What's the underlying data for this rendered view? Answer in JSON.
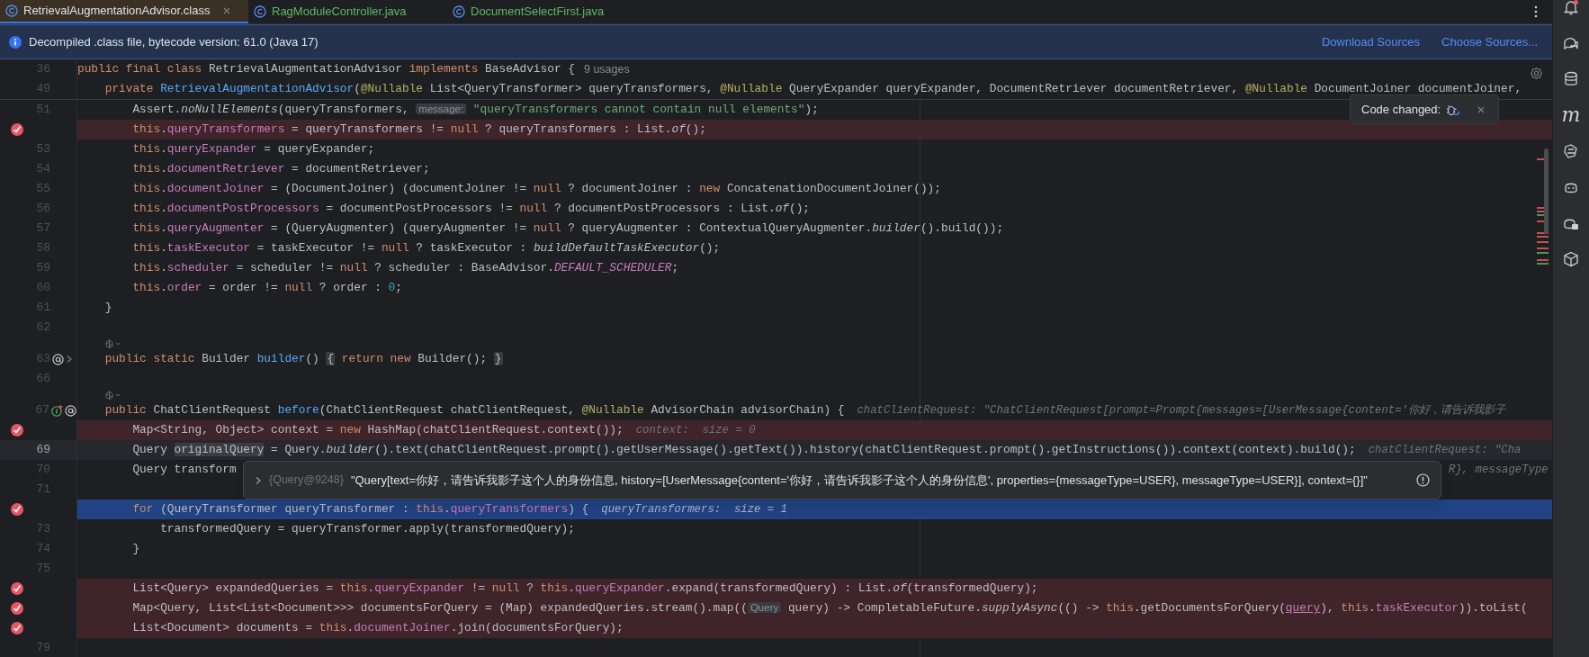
{
  "tabs": [
    {
      "label": "RetrievalAugmentationAdvisor.class",
      "selected": true,
      "color": "#dfe1e5"
    },
    {
      "label": "RagModuleController.java",
      "selected": false,
      "color": "#5fb865"
    },
    {
      "label": "DocumentSelectFirst.java",
      "selected": false,
      "color": "#5fb865"
    }
  ],
  "banner": {
    "message": "Decompiled .class file, bytecode version: 61.0 (Java 17)",
    "links": [
      "Download Sources",
      "Choose Sources..."
    ]
  },
  "sticky_lines": [
    {
      "number": "36",
      "tokens": [
        {
          "text": "public final class ",
          "kind": "keyword"
        },
        {
          "text": "RetrievalAugmentationAdvisor ",
          "kind": "plain"
        },
        {
          "text": "implements ",
          "kind": "keyword"
        },
        {
          "text": "BaseAdvisor {",
          "kind": "plain"
        }
      ],
      "hint": {
        "kind": "usages",
        "text": "9 usages"
      }
    },
    {
      "number": "49",
      "tokens": [
        {
          "text": "    private ",
          "kind": "keyword"
        },
        {
          "text": "RetrievalAugmentationAdvisor",
          "kind": "method"
        },
        {
          "text": "(",
          "kind": "plain"
        },
        {
          "text": "@Nullable",
          "kind": "annotation"
        },
        {
          "text": " List<QueryTransformer> queryTransformers, ",
          "kind": "plain"
        },
        {
          "text": "@Nullable",
          "kind": "annotation"
        },
        {
          "text": " QueryExpander queryExpander, DocumentRetriever documentRetriever, ",
          "kind": "plain"
        },
        {
          "text": "@Nullable",
          "kind": "annotation"
        },
        {
          "text": " DocumentJoiner documentJoiner, ",
          "kind": "plain"
        }
      ]
    }
  ],
  "lines": [
    {
      "kind": "code",
      "number": "51",
      "breakpoint": false,
      "execution_point": false,
      "caret_line": false,
      "tokens": [
        {
          "text": "        Assert.",
          "kind": "plain"
        },
        {
          "text": "noNullElements",
          "kind": "static"
        },
        {
          "text": "(queryTransformers, ",
          "kind": "plain"
        },
        {
          "text": "message:",
          "kind": "param_hint"
        },
        {
          "text": " \"queryTransformers cannot contain null elements\"",
          "kind": "string"
        },
        {
          "text": ");",
          "kind": "plain"
        }
      ]
    },
    {
      "kind": "code",
      "breakpoint": true,
      "execution_point": false,
      "caret_line": false,
      "tokens": [
        {
          "text": "        this",
          "kind": "keyword"
        },
        {
          "text": ".",
          "kind": "plain"
        },
        {
          "text": "queryTransformers",
          "kind": "field"
        },
        {
          "text": " = queryTransformers != ",
          "kind": "plain"
        },
        {
          "text": "null",
          "kind": "keyword"
        },
        {
          "text": " ? queryTransformers : List.",
          "kind": "plain"
        },
        {
          "text": "of",
          "kind": "static"
        },
        {
          "text": "();",
          "kind": "plain"
        }
      ]
    },
    {
      "kind": "code",
      "number": "53",
      "breakpoint": false,
      "execution_point": false,
      "caret_line": false,
      "tokens": [
        {
          "text": "        this",
          "kind": "keyword"
        },
        {
          "text": ".",
          "kind": "plain"
        },
        {
          "text": "queryExpander",
          "kind": "field"
        },
        {
          "text": " = queryExpander;",
          "kind": "plain"
        }
      ]
    },
    {
      "kind": "code",
      "number": "54",
      "breakpoint": false,
      "execution_point": false,
      "caret_line": false,
      "tokens": [
        {
          "text": "        this",
          "kind": "keyword"
        },
        {
          "text": ".",
          "kind": "plain"
        },
        {
          "text": "documentRetriever",
          "kind": "field"
        },
        {
          "text": " = documentRetriever;",
          "kind": "plain"
        }
      ]
    },
    {
      "kind": "code",
      "number": "55",
      "breakpoint": false,
      "execution_point": false,
      "caret_line": false,
      "tokens": [
        {
          "text": "        this",
          "kind": "keyword"
        },
        {
          "text": ".",
          "kind": "plain"
        },
        {
          "text": "documentJoiner",
          "kind": "field"
        },
        {
          "text": " = (DocumentJoiner) (documentJoiner != ",
          "kind": "plain"
        },
        {
          "text": "null",
          "kind": "keyword"
        },
        {
          "text": " ? documentJoiner : ",
          "kind": "plain"
        },
        {
          "text": "new ",
          "kind": "keyword"
        },
        {
          "text": "ConcatenationDocumentJoiner());",
          "kind": "plain"
        }
      ]
    },
    {
      "kind": "code",
      "number": "56",
      "breakpoint": false,
      "execution_point": false,
      "caret_line": false,
      "tokens": [
        {
          "text": "        this",
          "kind": "keyword"
        },
        {
          "text": ".",
          "kind": "plain"
        },
        {
          "text": "documentPostProcessors",
          "kind": "field"
        },
        {
          "text": " = documentPostProcessors != ",
          "kind": "plain"
        },
        {
          "text": "null",
          "kind": "keyword"
        },
        {
          "text": " ? documentPostProcessors : List.",
          "kind": "plain"
        },
        {
          "text": "of",
          "kind": "static"
        },
        {
          "text": "();",
          "kind": "plain"
        }
      ]
    },
    {
      "kind": "code",
      "number": "57",
      "breakpoint": false,
      "execution_point": false,
      "caret_line": false,
      "tokens": [
        {
          "text": "        this",
          "kind": "keyword"
        },
        {
          "text": ".",
          "kind": "plain"
        },
        {
          "text": "queryAugmenter",
          "kind": "field"
        },
        {
          "text": " = (QueryAugmenter) (queryAugmenter != ",
          "kind": "plain"
        },
        {
          "text": "null",
          "kind": "keyword"
        },
        {
          "text": " ? queryAugmenter : ContextualQueryAugmenter.",
          "kind": "plain"
        },
        {
          "text": "builder",
          "kind": "static"
        },
        {
          "text": "().build());",
          "kind": "plain"
        }
      ]
    },
    {
      "kind": "code",
      "number": "58",
      "breakpoint": false,
      "execution_point": false,
      "caret_line": false,
      "tokens": [
        {
          "text": "        this",
          "kind": "keyword"
        },
        {
          "text": ".",
          "kind": "plain"
        },
        {
          "text": "taskExecutor",
          "kind": "field"
        },
        {
          "text": " = taskExecutor != ",
          "kind": "plain"
        },
        {
          "text": "null",
          "kind": "keyword"
        },
        {
          "text": " ? taskExecutor : ",
          "kind": "plain"
        },
        {
          "text": "buildDefaultTaskExecutor",
          "kind": "static"
        },
        {
          "text": "();",
          "kind": "plain"
        }
      ]
    },
    {
      "kind": "code",
      "number": "59",
      "breakpoint": false,
      "execution_point": false,
      "caret_line": false,
      "tokens": [
        {
          "text": "        this",
          "kind": "keyword"
        },
        {
          "text": ".",
          "kind": "plain"
        },
        {
          "text": "scheduler",
          "kind": "field"
        },
        {
          "text": " = scheduler != ",
          "kind": "plain"
        },
        {
          "text": "null",
          "kind": "keyword"
        },
        {
          "text": " ? scheduler : BaseAdvisor.",
          "kind": "plain"
        },
        {
          "text": "DEFAULT_SCHEDULER",
          "kind": "constant"
        },
        {
          "text": ";",
          "kind": "plain"
        }
      ]
    },
    {
      "kind": "code",
      "number": "60",
      "breakpoint": false,
      "execution_point": false,
      "caret_line": false,
      "tokens": [
        {
          "text": "        this",
          "kind": "keyword"
        },
        {
          "text": ".",
          "kind": "plain"
        },
        {
          "text": "order",
          "kind": "field"
        },
        {
          "text": " = order != ",
          "kind": "plain"
        },
        {
          "text": "null",
          "kind": "keyword"
        },
        {
          "text": " ? order : ",
          "kind": "plain"
        },
        {
          "text": "0",
          "kind": "number"
        },
        {
          "text": ";",
          "kind": "plain"
        }
      ]
    },
    {
      "kind": "code",
      "number": "61",
      "breakpoint": false,
      "execution_point": false,
      "caret_line": false,
      "tokens": [
        {
          "text": "    }",
          "kind": "plain"
        }
      ]
    },
    {
      "kind": "code",
      "number": "62",
      "breakpoint": false,
      "execution_point": false,
      "caret_line": false
    },
    {
      "kind": "hint"
    },
    {
      "kind": "code",
      "number": "63",
      "breakpoint": false,
      "execution_point": false,
      "caret_line": false,
      "gutter_icons": [
        {
          "kind": "annotation"
        },
        {
          "kind": "fold"
        }
      ],
      "tokens": [
        {
          "text": "    public static ",
          "kind": "keyword"
        },
        {
          "text": "Builder ",
          "kind": "plain"
        },
        {
          "text": "builder",
          "kind": "method"
        },
        {
          "text": "() ",
          "kind": "plain"
        },
        {
          "text": "{",
          "kind": "fold"
        },
        {
          "text": " return new ",
          "kind": "keyword"
        },
        {
          "text": "Builder(); ",
          "kind": "plain"
        },
        {
          "text": "}",
          "kind": "fold"
        }
      ]
    },
    {
      "kind": "code",
      "number": "66",
      "breakpoint": false,
      "execution_point": false,
      "caret_line": false
    },
    {
      "kind": "hint"
    },
    {
      "kind": "code",
      "number": "67",
      "breakpoint": false,
      "execution_point": false,
      "caret_line": false,
      "gutter_icons": [
        {
          "kind": "implements"
        },
        {
          "kind": "annotation"
        }
      ],
      "tokens": [
        {
          "text": "    public ",
          "kind": "keyword"
        },
        {
          "text": "ChatClientRequest ",
          "kind": "plain"
        },
        {
          "text": "before",
          "kind": "method"
        },
        {
          "text": "(ChatClientRequest chatClientRequest, ",
          "kind": "plain"
        },
        {
          "text": "@Nullable",
          "kind": "annotation"
        },
        {
          "text": " AdvisorChain advisorChain) {",
          "kind": "plain"
        }
      ],
      "hint": {
        "kind": "debug",
        "text": "chatClientRequest: \"ChatClientRequest[prompt=Prompt{messages=[UserMessage{content='你好，请告诉我影子"
      }
    },
    {
      "kind": "code",
      "breakpoint": true,
      "execution_point": false,
      "caret_line": false,
      "tokens": [
        {
          "text": "        Map<String, Object> context = ",
          "kind": "plain"
        },
        {
          "text": "new ",
          "kind": "keyword"
        },
        {
          "text": "HashMap(chatClientRequest.context());",
          "kind": "plain"
        }
      ],
      "hint": {
        "kind": "debug",
        "text": "context:  size = 0"
      }
    },
    {
      "kind": "code",
      "number": "69",
      "breakpoint": false,
      "execution_point": false,
      "caret_line": true,
      "tokens": [
        {
          "text": "        Query ",
          "kind": "plain"
        },
        {
          "text": "originalQuery",
          "kind": "selection"
        },
        {
          "text": " = Query.",
          "kind": "plain"
        },
        {
          "text": "builder",
          "kind": "static"
        },
        {
          "text": "().text(chatClientRequest.prompt().getUserMessage().getText()).history(chatClientRequest.prompt().getInstructions()).context(context).build();",
          "kind": "plain"
        }
      ],
      "hint": {
        "kind": "debug",
        "text": "chatClientRequest: \"Cha"
      }
    },
    {
      "kind": "code",
      "number": "70",
      "breakpoint": false,
      "execution_point": false,
      "caret_line": false,
      "tokens": [
        {
          "text": "        Query transform",
          "kind": "plain"
        }
      ],
      "hint": {
        "kind": "overflow",
        "text": "R}, messageType"
      },
      "popup": {
        "type_label": "{Query@9248}",
        "value": "\"Query[text=你好，请告诉我影子这个人的身份信息, history=[UserMessage{content='你好，请告诉我影子这个人的身份信息', properties={messageType=USER}, messageType=USER}], context={}]\""
      }
    },
    {
      "kind": "code",
      "number": "71",
      "breakpoint": false,
      "execution_point": false,
      "caret_line": false
    },
    {
      "kind": "code",
      "breakpoint": true,
      "execution_point": true,
      "caret_line": false,
      "tokens": [
        {
          "text": "        for ",
          "kind": "keyword"
        },
        {
          "text": "(QueryTransformer queryTransformer : ",
          "kind": "plain"
        },
        {
          "text": "this",
          "kind": "keyword"
        },
        {
          "text": ".",
          "kind": "plain"
        },
        {
          "text": "queryTransformers",
          "kind": "field"
        },
        {
          "text": ") {",
          "kind": "plain"
        }
      ],
      "hint": {
        "kind": "debug",
        "text": "queryTransformers:  size = 1"
      }
    },
    {
      "kind": "code",
      "number": "73",
      "breakpoint": false,
      "execution_point": false,
      "caret_line": false,
      "tokens": [
        {
          "text": "            transformedQuery = queryTransformer.apply(transformedQuery);",
          "kind": "plain"
        }
      ]
    },
    {
      "kind": "code",
      "number": "74",
      "breakpoint": false,
      "execution_point": false,
      "caret_line": false,
      "tokens": [
        {
          "text": "        }",
          "kind": "plain"
        }
      ]
    },
    {
      "kind": "code",
      "number": "75",
      "breakpoint": false,
      "execution_point": false,
      "caret_line": false
    },
    {
      "kind": "code",
      "breakpoint": true,
      "execution_point": false,
      "caret_line": false,
      "tokens": [
        {
          "text": "        List<Query> expandedQueries = ",
          "kind": "plain"
        },
        {
          "text": "this",
          "kind": "keyword"
        },
        {
          "text": ".",
          "kind": "plain"
        },
        {
          "text": "queryExpander",
          "kind": "field"
        },
        {
          "text": " != ",
          "kind": "plain"
        },
        {
          "text": "null",
          "kind": "keyword"
        },
        {
          "text": " ? ",
          "kind": "plain"
        },
        {
          "text": "this",
          "kind": "keyword"
        },
        {
          "text": ".",
          "kind": "plain"
        },
        {
          "text": "queryExpander",
          "kind": "field"
        },
        {
          "text": ".expand(transformedQuery) : List.",
          "kind": "plain"
        },
        {
          "text": "of",
          "kind": "static"
        },
        {
          "text": "(transformedQuery);",
          "kind": "plain"
        }
      ]
    },
    {
      "kind": "code",
      "breakpoint": true,
      "execution_point": false,
      "caret_line": false,
      "tokens": [
        {
          "text": "        Map<Query, List<List<Document>>> documentsForQuery = (Map) expandedQueries.stream().map((",
          "kind": "plain"
        },
        {
          "text": "Query",
          "kind": "param_hint"
        },
        {
          "text": " query) -> CompletableFuture.",
          "kind": "plain"
        },
        {
          "text": "supplyAsync",
          "kind": "static"
        },
        {
          "text": "(() -> ",
          "kind": "plain"
        },
        {
          "text": "this",
          "kind": "keyword"
        },
        {
          "text": ".getDocumentsForQuery(",
          "kind": "plain"
        },
        {
          "text": "query",
          "kind": "reference"
        },
        {
          "text": "), ",
          "kind": "plain"
        },
        {
          "text": "this",
          "kind": "keyword"
        },
        {
          "text": ".",
          "kind": "plain"
        },
        {
          "text": "taskExecutor",
          "kind": "field"
        },
        {
          "text": ")).toList(",
          "kind": "plain"
        }
      ]
    },
    {
      "kind": "code",
      "breakpoint": true,
      "execution_point": false,
      "caret_line": false,
      "tokens": [
        {
          "text": "        List<Document> documents = ",
          "kind": "plain"
        },
        {
          "text": "this",
          "kind": "keyword"
        },
        {
          "text": ".",
          "kind": "plain"
        },
        {
          "text": "documentJoiner",
          "kind": "field"
        },
        {
          "text": ".join(documentsForQuery);",
          "kind": "plain"
        }
      ]
    },
    {
      "kind": "code",
      "number": "79",
      "breakpoint": false,
      "execution_point": false,
      "caret_line": false
    }
  ],
  "code_changed": {
    "label": "Code changed:"
  },
  "right_toolbar": {
    "maven_glyph": "m"
  }
}
